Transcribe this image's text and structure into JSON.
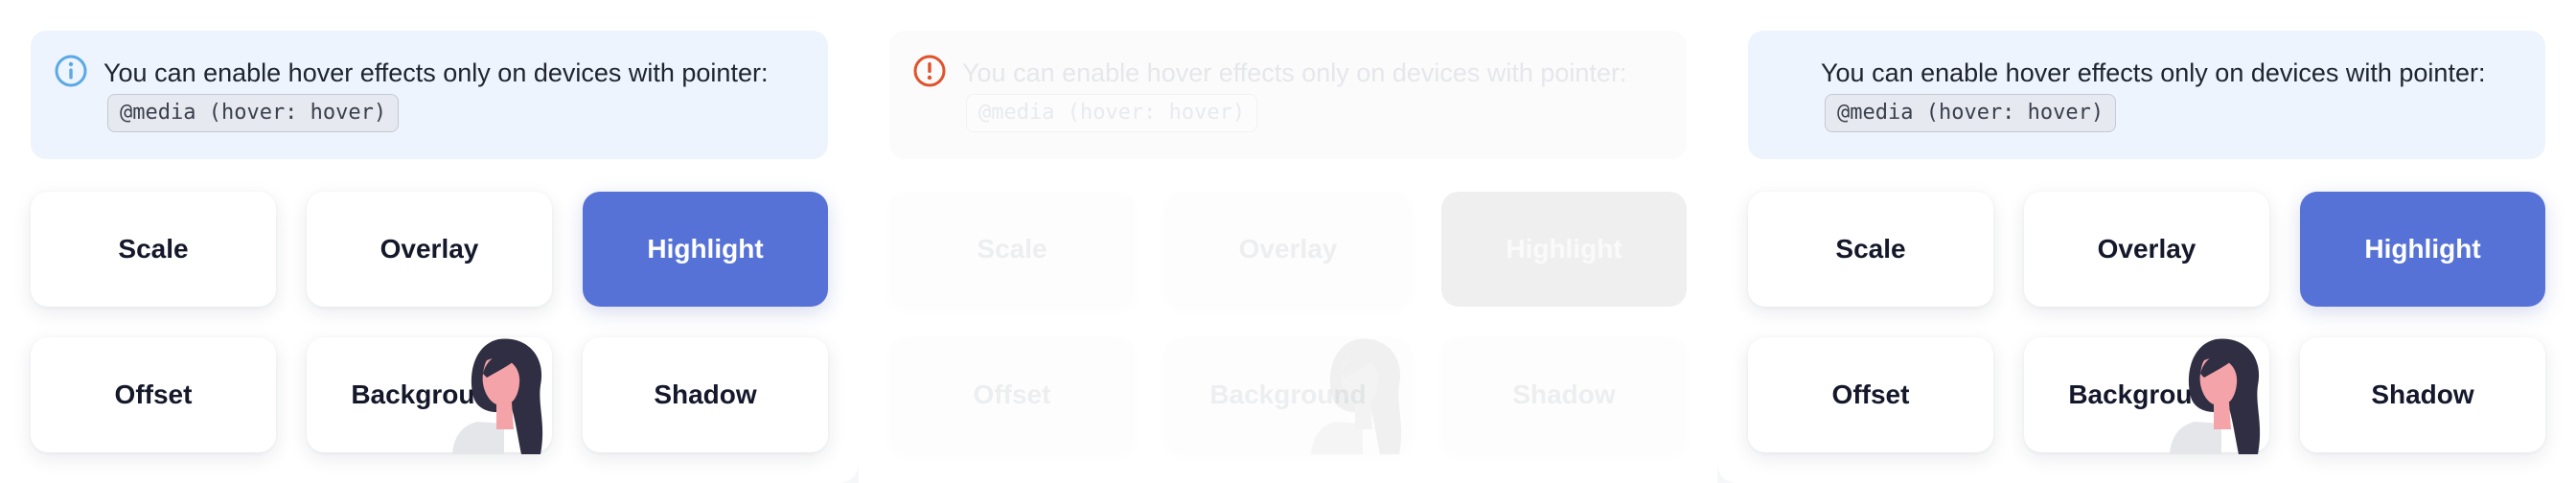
{
  "colors": {
    "alert_background": "#edf4fd",
    "info_icon": "#5aa9e6",
    "warning_icon": "#e0532a",
    "highlight_button": "#5672d7",
    "button_text": "#14182a"
  },
  "panels": [
    {
      "state": "default",
      "alert": {
        "icon": "info-icon",
        "text": "You can enable hover effects only on devices with pointer:",
        "code": "@media (hover: hover)"
      },
      "buttons": [
        "Scale",
        "Overlay",
        "Highlight",
        "Offset",
        "Background",
        "Shadow"
      ]
    },
    {
      "state": "disabled",
      "alert": {
        "icon": "warning-icon",
        "text": "You can enable hover effects only on devices with pointer:",
        "code": "@media (hover: hover)"
      },
      "buttons": [
        "Scale",
        "Overlay",
        "Highlight",
        "Offset",
        "Background",
        "Shadow"
      ]
    },
    {
      "state": "default",
      "alert": {
        "icon": "",
        "text": "You can enable hover effects only on devices with pointer:",
        "code": "@media (hover: hover)"
      },
      "buttons": [
        "Scale",
        "Overlay",
        "Highlight",
        "Offset",
        "Background",
        "Shadow"
      ]
    }
  ]
}
